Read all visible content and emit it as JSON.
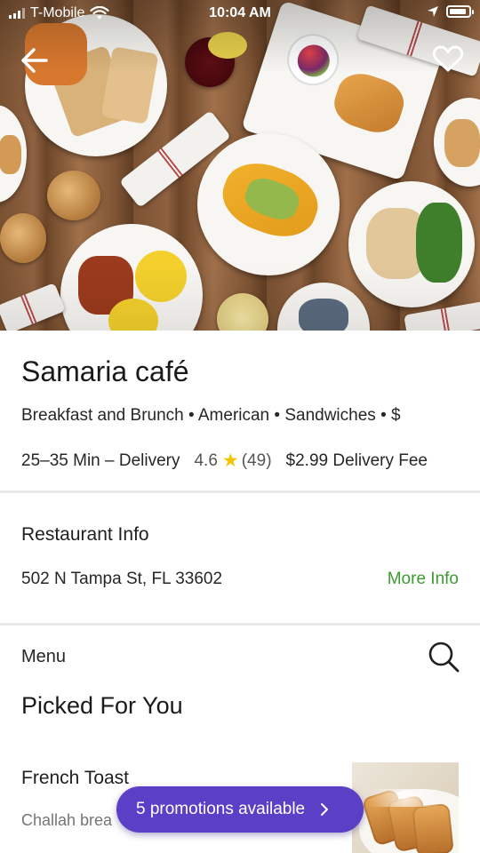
{
  "status_bar": {
    "carrier": "T-Mobile",
    "time": "10:04 AM",
    "icons": [
      "signal-icon",
      "wifi-icon",
      "location-arrow-icon",
      "battery-icon"
    ]
  },
  "header": {
    "back_icon": "back-arrow-icon",
    "favorite_icon": "heart-outline-icon"
  },
  "restaurant": {
    "name": "Samaria café",
    "cuisines": "Breakfast and Brunch • American • Sandwiches • $",
    "delivery_time": "25–35 Min – Delivery",
    "rating": "4.6",
    "rating_count": "(49)",
    "delivery_fee": "$2.99 Delivery Fee"
  },
  "info_section": {
    "title": "Restaurant Info",
    "address": "502 N Tampa St, FL 33602",
    "more_info_label": "More Info"
  },
  "menu": {
    "label": "Menu",
    "section_title": "Picked For You",
    "items": [
      {
        "name": "French Toast",
        "description": "Challah brea"
      }
    ]
  },
  "promo": {
    "label": "5 promotions available"
  },
  "colors": {
    "accent_green": "#3d9b2f",
    "promo_purple": "#5b3fc6",
    "star_yellow": "#f5c400"
  }
}
